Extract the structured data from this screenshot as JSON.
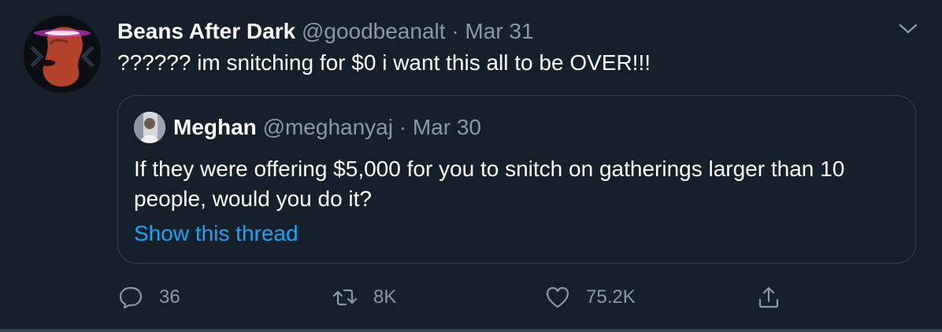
{
  "tweet": {
    "author_name": "Beans After Dark",
    "author_handle": "@goodbeanalt",
    "separator": "·",
    "date": "Mar 31",
    "text": "?????? im snitching for $0 i want this all to be OVER!!!",
    "avatar_icon": "bean-character-avatar",
    "more_icon": "chevron-down-icon"
  },
  "quoted": {
    "author_name": "Meghan",
    "author_handle": "@meghanyaj",
    "separator": "·",
    "date": "Mar 30",
    "text": "If they were offering $5,000 for you to snitch on gatherings larger than 10 people, would you do it?",
    "show_thread": "Show this thread"
  },
  "actions": {
    "reply_count": "36",
    "retweet_count": "8K",
    "like_count": "75.2K"
  },
  "colors": {
    "background": "#15202b",
    "secondary_text": "#8899a6",
    "link": "#1da1f2",
    "border": "#38444d",
    "avatar_bean": "#c0392b",
    "avatar_eyes": "#ff3cf2"
  }
}
